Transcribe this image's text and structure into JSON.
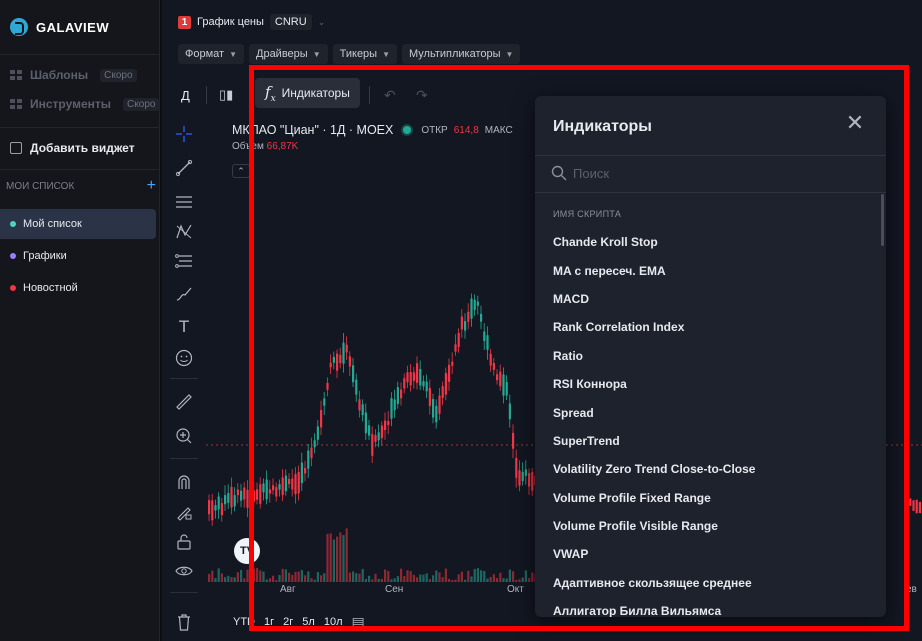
{
  "app": {
    "brand": "GALAVIEW",
    "sidebar": {
      "templates_label": "Шаблоны",
      "templates_badge": "Скоро",
      "tools_label": "Инструменты",
      "tools_badge": "Скоро",
      "add_widget_label": "Добавить виджет",
      "lists_header": "МОИ СПИСОК",
      "lists": [
        {
          "label": "Мой список",
          "color": "#4fd1c5",
          "active": true
        },
        {
          "label": "Графики",
          "color": "#9b7bff",
          "active": false
        },
        {
          "label": "Новостной",
          "color": "#f23645",
          "active": false
        }
      ]
    }
  },
  "widget": {
    "tab_number": "1",
    "tab_title": "График цены",
    "ticker": "CNRU",
    "filters": [
      "Формат",
      "Драйверы",
      "Тикеры",
      "Мультипликаторы"
    ]
  },
  "toolbar": {
    "interval": "Д",
    "indicators_label": "Индикаторы"
  },
  "chart": {
    "title": "МКПАО \"Циан\" · 1Д · MOEX",
    "open_label": "ОТКР",
    "open_value": "614,8",
    "max_label": "МАКС",
    "volume_label": "Объем",
    "volume_value": "66,87K",
    "months": [
      "Авг",
      "Сен",
      "Окт",
      "ев"
    ],
    "colors": {
      "up": "#22ab94",
      "down": "#f23645"
    },
    "periods": [
      "YTD",
      "1г",
      "2г",
      "5л",
      "10л"
    ]
  },
  "dialog": {
    "title": "Индикаторы",
    "search_placeholder": "Поиск",
    "list_header": "ИМЯ СКРИПТА",
    "items": [
      "Chande Kroll Stop",
      "MA с пересеч. EMA",
      "MACD",
      "Rank Correlation Index",
      "Ratio",
      "RSI Коннора",
      "Spread",
      "SuperTrend",
      "Volatility Zero Trend Close-to-Close",
      "Volume Profile Fixed Range",
      "Volume Profile Visible Range",
      "VWAP",
      "Адаптивное скользящее среднее",
      "Аллигатор Билла Вильямса"
    ]
  }
}
